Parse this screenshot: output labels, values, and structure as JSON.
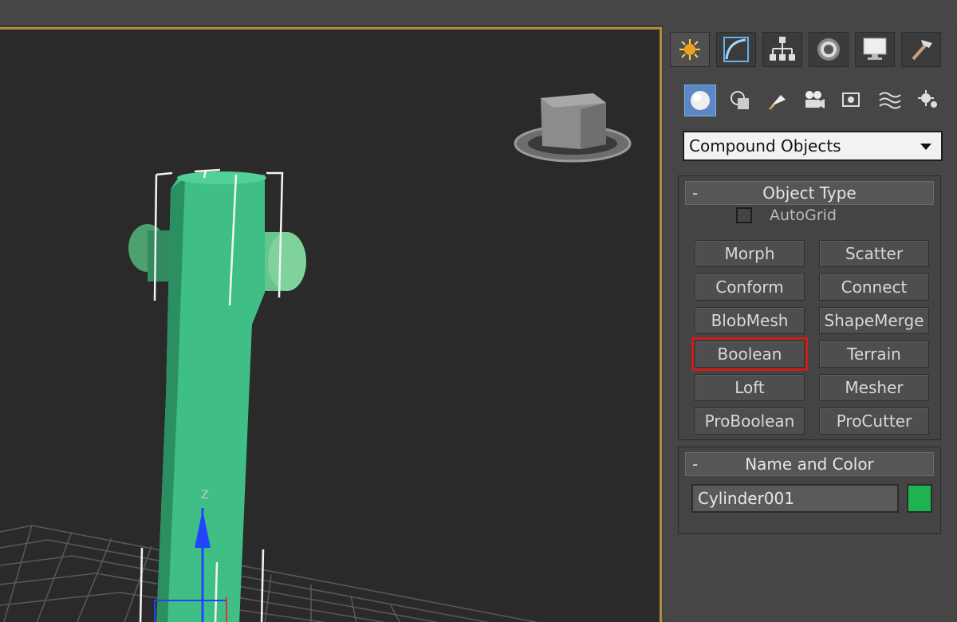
{
  "panel": {
    "tabs": [
      {
        "icon": "create-icon",
        "active": true
      },
      {
        "icon": "modify-icon",
        "active": false
      },
      {
        "icon": "hierarchy-icon",
        "active": false
      },
      {
        "icon": "motion-icon",
        "active": false
      },
      {
        "icon": "display-icon",
        "active": false
      },
      {
        "icon": "utilities-icon",
        "active": false
      }
    ],
    "categories": [
      {
        "icon": "geometry-sphere-icon",
        "active": true
      },
      {
        "icon": "shapes-icon",
        "active": false
      },
      {
        "icon": "lights-icon",
        "active": false
      },
      {
        "icon": "cameras-icon",
        "active": false
      },
      {
        "icon": "helpers-icon",
        "active": false
      },
      {
        "icon": "space-warps-icon",
        "active": false
      },
      {
        "icon": "systems-icon",
        "active": false
      }
    ],
    "dropdown_value": "Compound Objects",
    "object_type": {
      "title": "Object Type",
      "collapse": "-",
      "autogrid_label": "AutoGrid",
      "buttons": [
        "Morph",
        "Scatter",
        "Conform",
        "Connect",
        "BlobMesh",
        "ShapeMerge",
        "Boolean",
        "Terrain",
        "Loft",
        "Mesher",
        "ProBoolean",
        "ProCutter"
      ],
      "highlighted": "Boolean"
    },
    "name_color": {
      "title": "Name and Color",
      "collapse": "-",
      "name": "Cylinder001",
      "color": "#1db34f"
    }
  },
  "viewport": {
    "gizmo_axis_label": "Z",
    "object_color": "#3fbf86",
    "frame_color": "#b38a3c"
  }
}
